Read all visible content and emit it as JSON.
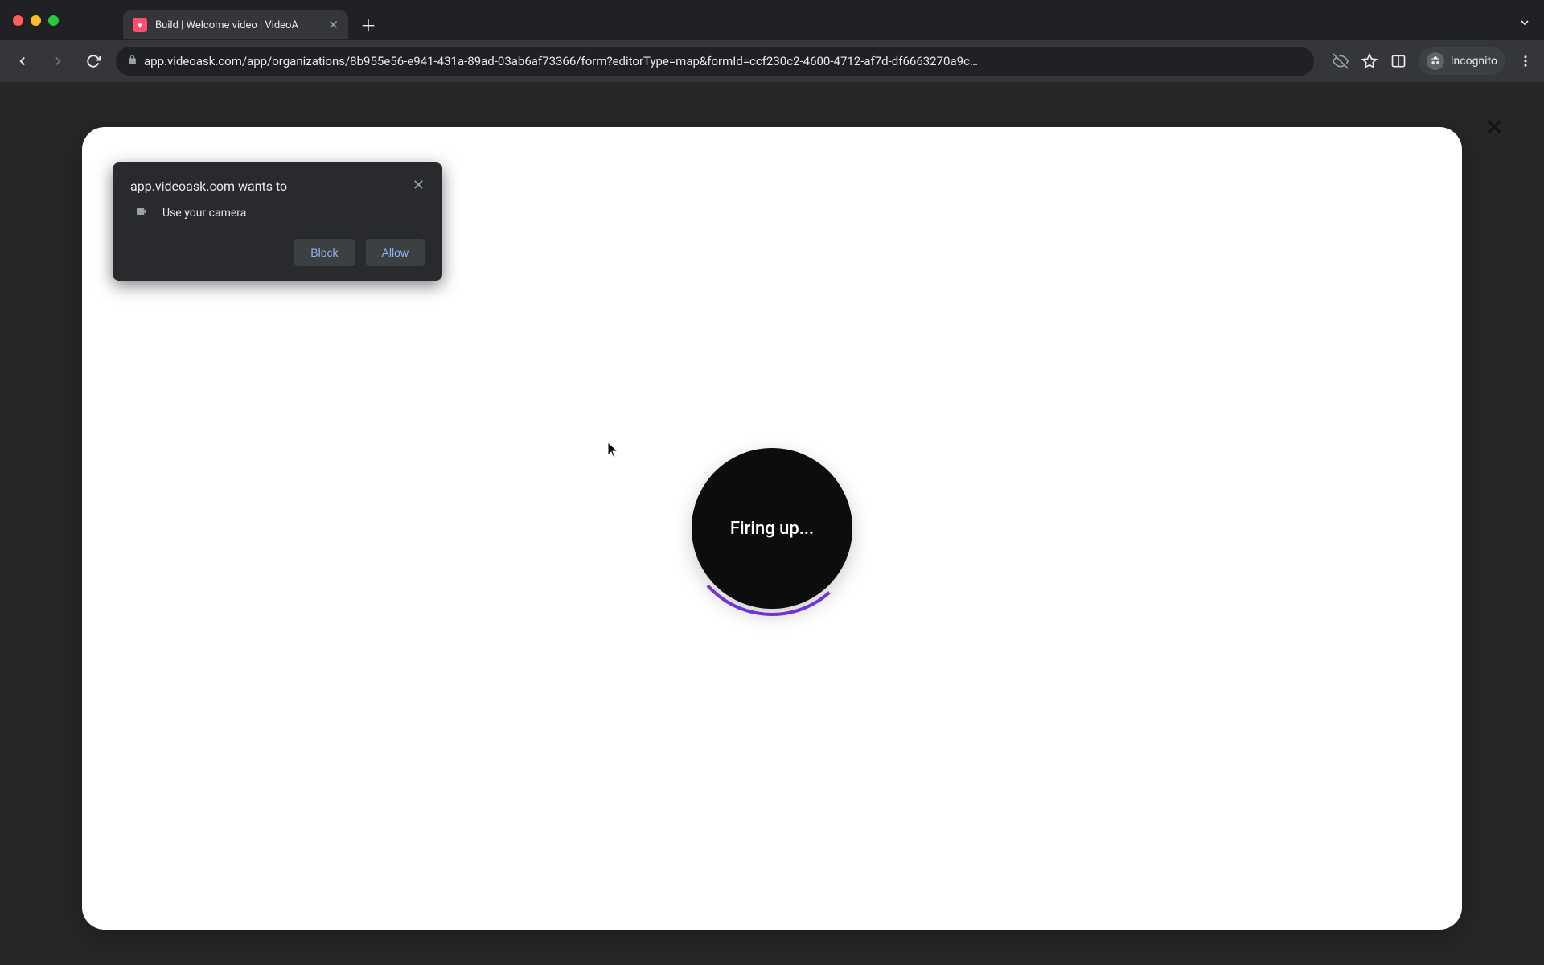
{
  "browser": {
    "tab_title": "Build | Welcome video | VideoA",
    "url": "app.videoask.com/app/organizations/8b955e56-e941-431a-89ad-03ab6af73366/form?editorType=map&formId=ccf230c2-4600-4712-af7d-df6663270a9c…",
    "incognito_label": "Incognito"
  },
  "permission_prompt": {
    "title": "app.videoask.com wants to",
    "item": "Use your camera",
    "block_label": "Block",
    "allow_label": "Allow"
  },
  "app": {
    "loading_text": "Firing up..."
  }
}
